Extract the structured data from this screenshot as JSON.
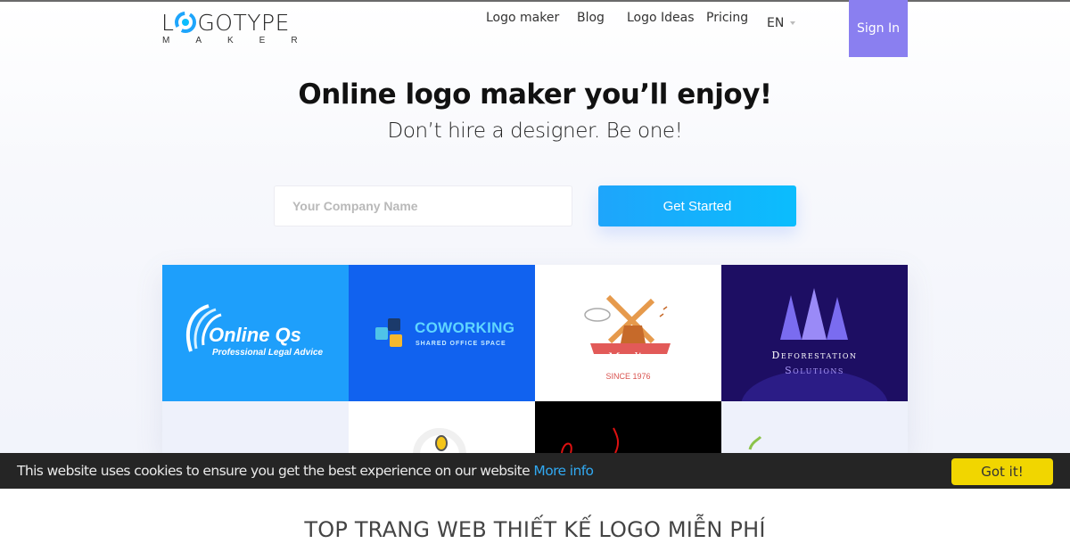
{
  "header": {
    "logo_main_prefix": "L",
    "logo_main_suffix": "GOTYPE",
    "logo_sub": "MAKER",
    "nav": [
      {
        "label": "Logo maker"
      },
      {
        "label": "Blog"
      },
      {
        "label": "Logo Ideas"
      },
      {
        "label": "Pricing"
      },
      {
        "label": "EN"
      }
    ],
    "sign_in_label": "Sign In",
    "accent_color": "#8a7ff0"
  },
  "hero": {
    "title": "Online logo maker you’ll enjoy!",
    "subtitle": "Don’t hire a designer. Be one!",
    "company_input": {
      "value": "",
      "placeholder": "Your Company Name"
    },
    "cta_label": "Get Started",
    "cta_color": "#1ea5fb"
  },
  "logo_gallery": [
    {
      "title": "Online Qs",
      "subtitle": "Professional Legal Advice"
    },
    {
      "title": "COWORKING",
      "subtitle": "SHARED OFFICE SPACE"
    },
    {
      "title": "Moulin",
      "subtitle": "SINCE 1976"
    },
    {
      "title": "Deforestation",
      "subtitle": "Solutions"
    }
  ],
  "cookie_banner": {
    "message": "This website uses cookies to ensure you get the best experience on our website",
    "link_label": "More info",
    "accept_label": "Got it!",
    "accept_color": "#f1d600"
  },
  "section": {
    "title": "TOP TRANG WEB THIẾT KẾ LOGO MIỄN PHÍ"
  }
}
